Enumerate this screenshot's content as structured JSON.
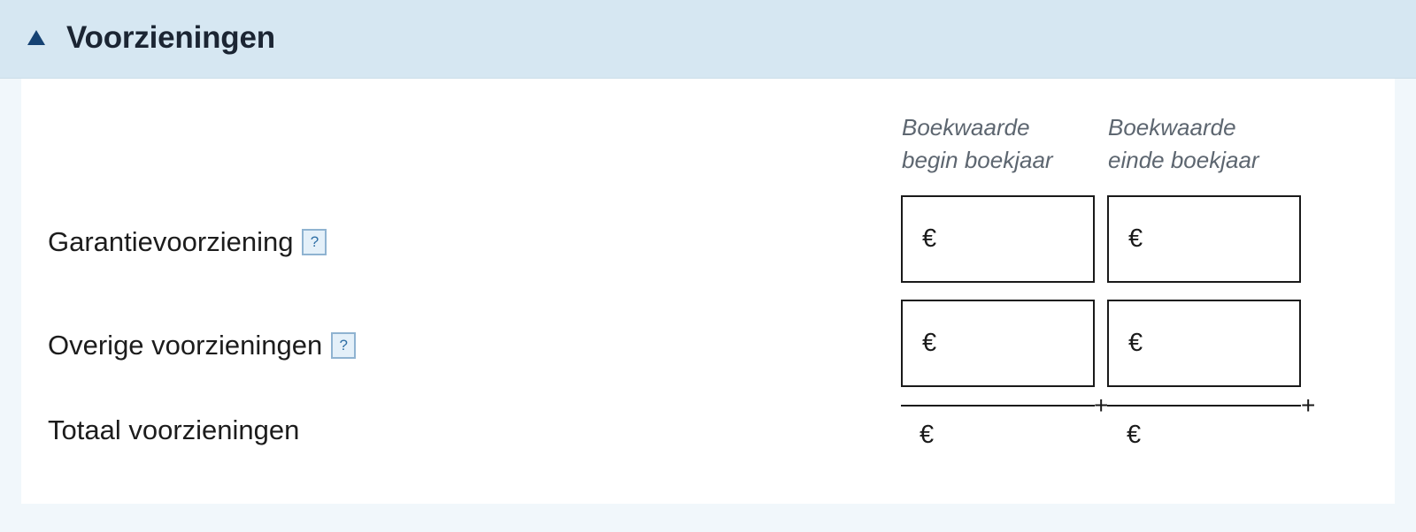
{
  "section": {
    "title": "Voorzieningen",
    "collapse_icon": "triangle-up-icon"
  },
  "columns": [
    {
      "line1": "Boekwaarde",
      "line2": "begin boekjaar"
    },
    {
      "line1": "Boekwaarde",
      "line2": "einde boekjaar"
    }
  ],
  "rows": [
    {
      "label": "Garantievoorziening",
      "help": "?",
      "currency": "€",
      "begin_value": "",
      "end_value": ""
    },
    {
      "label": "Overige voorzieningen",
      "help": "?",
      "currency": "€",
      "begin_value": "",
      "end_value": ""
    }
  ],
  "total": {
    "label": "Totaal voorzieningen",
    "operator": "+",
    "currency": "€",
    "begin_value": "",
    "end_value": ""
  },
  "colors": {
    "header_bg": "#d6e7f2",
    "accent": "#154273",
    "help_border": "#8fb3d1"
  }
}
